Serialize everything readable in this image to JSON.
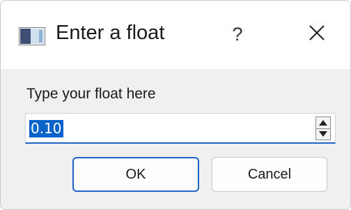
{
  "dialog": {
    "title": "Enter a float",
    "help_label": "?",
    "close_icon": "close-icon",
    "app_icon": "window-icon",
    "prompt": "Type your float here",
    "value": "0.10",
    "ok_label": "OK",
    "cancel_label": "Cancel"
  },
  "colors": {
    "accent": "#1e64c8",
    "selection": "#0a63c8",
    "titlebar_bg": "#ffffff",
    "body_bg": "#f0f0f0"
  }
}
